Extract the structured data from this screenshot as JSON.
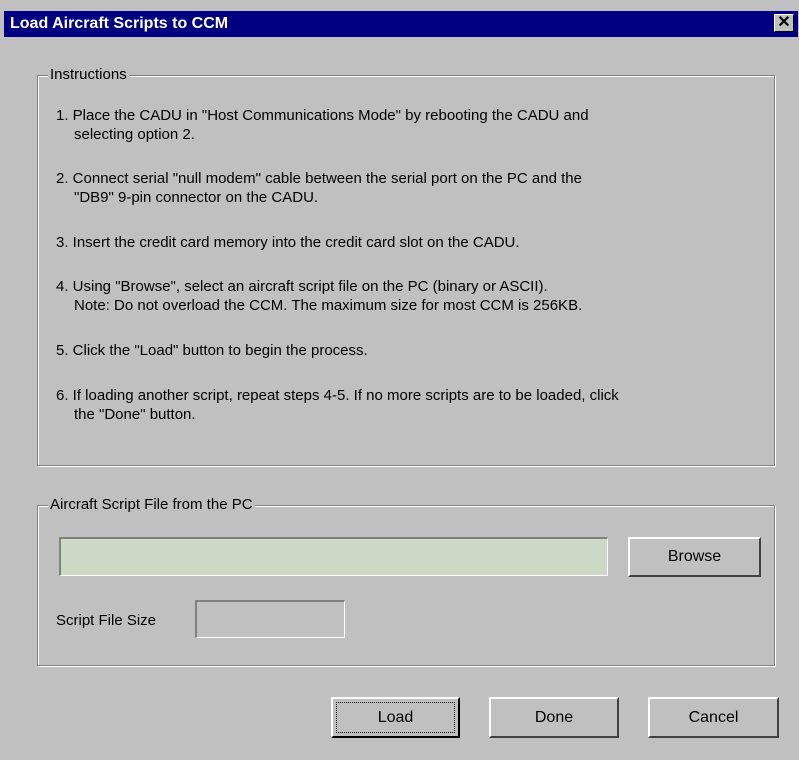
{
  "window": {
    "title": "Load Aircraft Scripts to CCM",
    "close_glyph": "✕"
  },
  "instructions": {
    "group_label": "Instructions",
    "steps": [
      {
        "line1": "1. Place the CADU in \"Host Communications Mode\" by rebooting the CADU and",
        "line2": "selecting option 2."
      },
      {
        "line1": "2. Connect serial \"null modem\" cable between the serial port on the PC and the",
        "line2": "\"DB9\" 9-pin connector on the CADU."
      },
      {
        "line1": "3. Insert the credit card memory into the credit card slot on the CADU.",
        "line2": ""
      },
      {
        "line1": "4. Using \"Browse\", select an aircraft script file on the PC (binary or ASCII).",
        "line2": "Note: Do not overload the CCM. The maximum size for most CCM is 256KB."
      },
      {
        "line1": "5. Click the \"Load\" button to begin the process.",
        "line2": ""
      },
      {
        "line1": "6. If loading another script, repeat steps 4-5. If no more scripts are to be loaded, click",
        "line2": "the \"Done\" button."
      }
    ]
  },
  "file_section": {
    "group_label": "Aircraft Script File from the PC",
    "path_value": "",
    "browse_label": "Browse",
    "size_label": "Script File Size",
    "size_value": ""
  },
  "buttons": {
    "load": "Load",
    "done": "Done",
    "cancel": "Cancel"
  },
  "colors": {
    "title_bar": "#000080",
    "dialog_bg": "#c0c0c0",
    "path_field_bg": "#cbd9c5"
  }
}
